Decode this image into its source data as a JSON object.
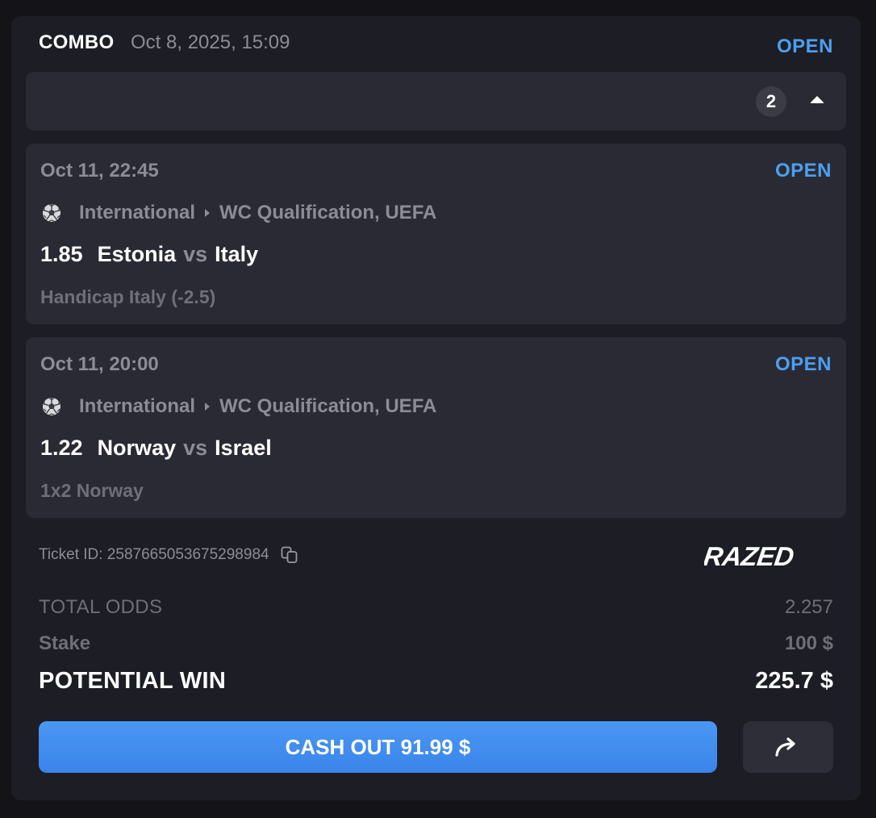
{
  "ticket": {
    "type_label": "COMBO",
    "placed_at": "Oct 8, 2025, 15:09",
    "status": "OPEN",
    "selections_count": "2",
    "ticket_id_label": "Ticket ID: 2587665053675298984",
    "brand": "RAZED"
  },
  "legs": [
    {
      "date": "Oct 11, 22:45",
      "status": "OPEN",
      "category": "International",
      "league": "WC Qualification, UEFA",
      "odds": "1.85",
      "home": "Estonia",
      "vs": "vs",
      "away": "Italy",
      "market": "Handicap Italy (-2.5)",
      "icon": "soccer-ball-icon"
    },
    {
      "date": "Oct 11, 20:00",
      "status": "OPEN",
      "category": "International",
      "league": "WC Qualification, UEFA",
      "odds": "1.22",
      "home": "Norway",
      "vs": "vs",
      "away": "Israel",
      "market": "1x2 Norway",
      "icon": "soccer-ball-icon"
    }
  ],
  "summary": {
    "total_odds_label": "TOTAL ODDS",
    "total_odds_value": "2.257",
    "stake_label": "Stake",
    "stake_value": "100 $",
    "potential_win_label": "POTENTIAL WIN",
    "potential_win_value": "225.7 $"
  },
  "actions": {
    "cashout_label": "CASH OUT 91.99 $",
    "share_icon": "share-arrow-icon",
    "copy_icon": "copy-icon",
    "collapse_icon": "caret-up-icon"
  },
  "colors": {
    "background": "#141418",
    "card": "#1d1d25",
    "panel": "#2a2a34",
    "accent": "#4c9ff0",
    "button": "#3a84ea"
  }
}
